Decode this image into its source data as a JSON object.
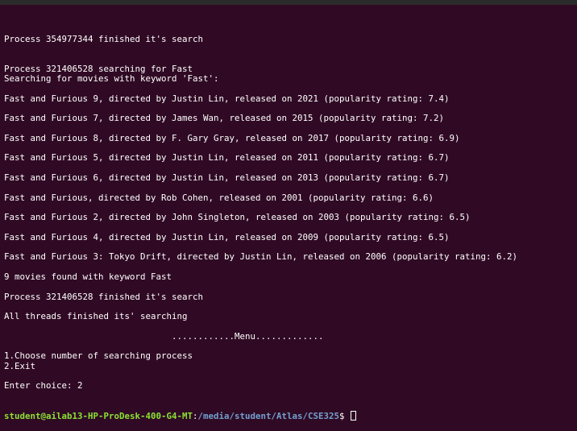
{
  "terminal": {
    "lines": [
      "",
      "Process 354977344 finished it's search",
      "",
      "",
      "Process 321406528 searching for Fast",
      "Searching for movies with keyword 'Fast':",
      "",
      "Fast and Furious 9, directed by Justin Lin, released on 2021 (popularity rating: 7.4)",
      "",
      "Fast and Furious 7, directed by James Wan, released on 2015 (popularity rating: 7.2)",
      "",
      "Fast and Furious 8, directed by F. Gary Gray, released on 2017 (popularity rating: 6.9)",
      "",
      "Fast and Furious 5, directed by Justin Lin, released on 2011 (popularity rating: 6.7)",
      "",
      "Fast and Furious 6, directed by Justin Lin, released on 2013 (popularity rating: 6.7)",
      "",
      "Fast and Furious, directed by Rob Cohen, released on 2001 (popularity rating: 6.6)",
      "",
      "Fast and Furious 2, directed by John Singleton, released on 2003 (popularity rating: 6.5)",
      "",
      "Fast and Furious 4, directed by Justin Lin, released on 2009 (popularity rating: 6.5)",
      "",
      "Fast and Furious 3: Tokyo Drift, directed by Justin Lin, released on 2006 (popularity rating: 6.2)",
      "",
      "9 movies found with keyword Fast",
      "",
      "Process 321406528 finished it's search",
      "",
      "All threads finished its' searching",
      "",
      "                                ............Menu.............",
      "",
      "1.Choose number of searching process",
      "2.Exit",
      "",
      "Enter choice: 2"
    ],
    "prompt": {
      "user_host": "student@ailab13-HP-ProDesk-400-G4-MT",
      "separator": ":",
      "path": "/media/student/Atlas/CSE325",
      "symbol": "$ "
    }
  },
  "colors": {
    "background": "#300a24",
    "text": "#ffffff",
    "prompt_user": "#8ae234",
    "prompt_path": "#729fcf"
  }
}
